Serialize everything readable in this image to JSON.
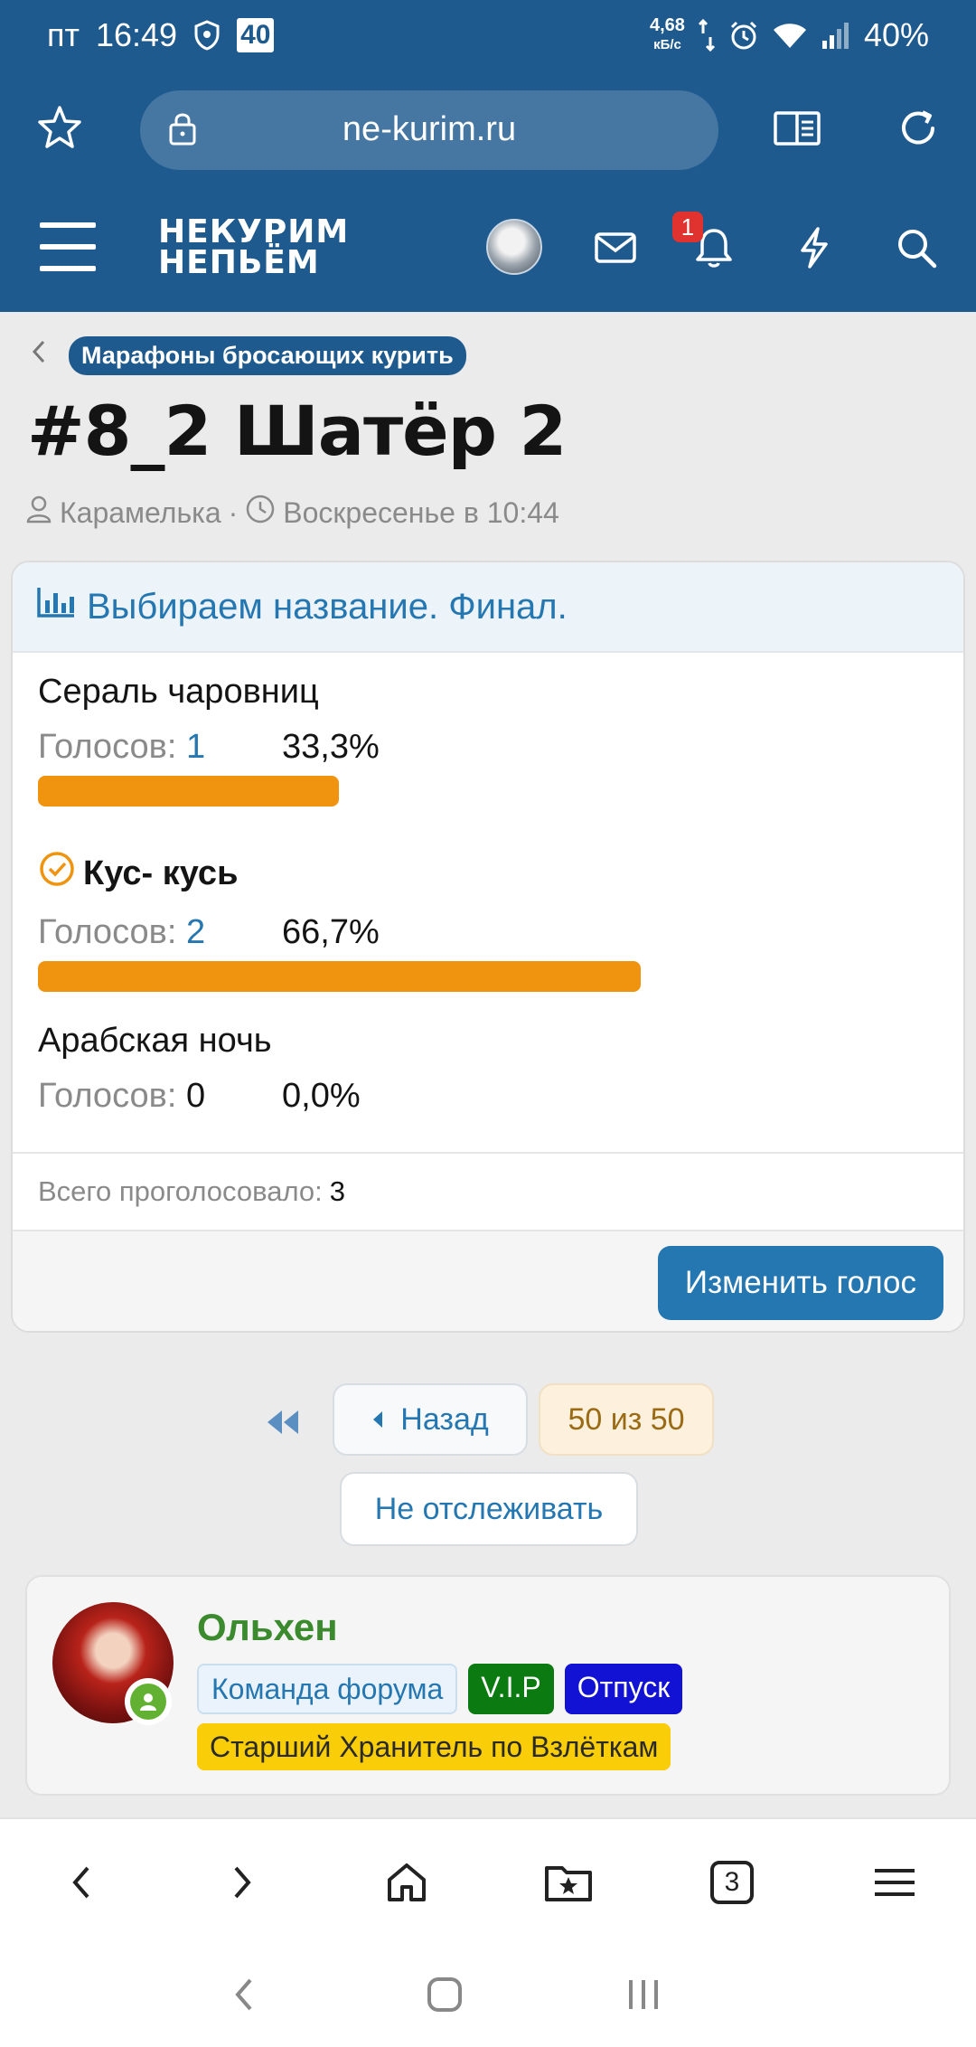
{
  "status_bar": {
    "day": "пт",
    "time": "16:49",
    "badge": "40",
    "net_speed_value": "4,68",
    "net_speed_unit": "кБ/с",
    "battery": "40%"
  },
  "browser": {
    "url": "ne-kurim.ru"
  },
  "site_header": {
    "logo_line1": "НЕКУРИМ",
    "logo_line2": "НЕПЬЁМ",
    "notification_count": "1"
  },
  "breadcrumb": {
    "label": "Марафоны бросающих курить"
  },
  "thread": {
    "title": "#8_2 Шатёр 2",
    "author": "Карамелька",
    "separator": "·",
    "date": "Воскресенье в 10:44"
  },
  "poll": {
    "title": "Выбираем название. Финал.",
    "votes_label": "Голосов:",
    "options": [
      {
        "name": "Сераль чаровниц",
        "votes": "1",
        "percent_text": "33,3%",
        "fraction": 0.333,
        "winner": false
      },
      {
        "name": "Кус- кусь",
        "votes": "2",
        "percent_text": "66,7%",
        "fraction": 0.667,
        "winner": true
      },
      {
        "name": "Арабская ночь",
        "votes": "0",
        "percent_text": "0,0%",
        "fraction": 0.0,
        "winner": false
      }
    ],
    "total_label": "Всего проголосовало:",
    "total_value": "3",
    "change_vote_label": "Изменить голос",
    "bar_color": "#f0940f"
  },
  "pager": {
    "back_label": "Назад",
    "current_label": "50 из 50",
    "unwatch_label": "Не отслеживать"
  },
  "post": {
    "username": "Ольхен",
    "tags": {
      "team": "Команда форума",
      "vip": "V.I.P",
      "vacation": "Отпуск",
      "keeper": "Старший Хранитель по Взлёткам"
    }
  },
  "bottom_nav": {
    "tabs_count": "3"
  },
  "colors": {
    "header_bg": "#1e5a8e",
    "link": "#2577b1",
    "username": "#3b8b2e"
  }
}
